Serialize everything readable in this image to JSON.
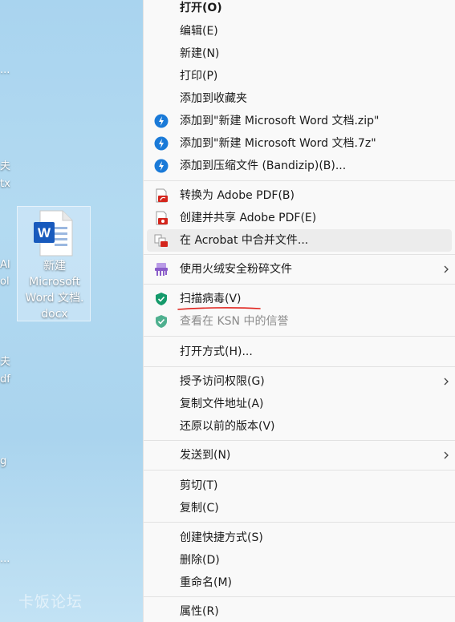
{
  "desktop": {
    "fragments": [
      "...",
      "夫",
      "tx",
      "AI",
      "ol",
      "夫",
      "df",
      "g",
      "..."
    ],
    "selected_file": {
      "label_lines": [
        "新建",
        "Microsoft",
        "Word 文档.",
        "docx"
      ]
    },
    "watermark": "卡饭论坛"
  },
  "menu": {
    "items": [
      {
        "label": "打开(O)"
      },
      {
        "label": "编辑(E)"
      },
      {
        "label": "新建(N)"
      },
      {
        "label": "打印(P)"
      },
      {
        "label": "添加到收藏夹"
      },
      {
        "label": "添加到\"新建 Microsoft Word 文档.zip\""
      },
      {
        "label": "添加到\"新建 Microsoft Word 文档.7z\""
      },
      {
        "label": "添加到压缩文件 (Bandizip)(B)..."
      },
      {
        "label": "转换为 Adobe PDF(B)"
      },
      {
        "label": "创建并共享 Adobe PDF(E)"
      },
      {
        "label": "在 Acrobat 中合并文件..."
      },
      {
        "label": "使用火绒安全粉碎文件"
      },
      {
        "label": "扫描病毒(V)"
      },
      {
        "label": "查看在 KSN 中的信誉"
      },
      {
        "label": "打开方式(H)..."
      },
      {
        "label": "授予访问权限(G)"
      },
      {
        "label": "复制文件地址(A)"
      },
      {
        "label": "还原以前的版本(V)"
      },
      {
        "label": "发送到(N)"
      },
      {
        "label": "剪切(T)"
      },
      {
        "label": "复制(C)"
      },
      {
        "label": "创建快捷方式(S)"
      },
      {
        "label": "删除(D)"
      },
      {
        "label": "重命名(M)"
      },
      {
        "label": "属性(R)"
      }
    ]
  },
  "colors": {
    "bandizip": "#1a7ad8",
    "adobe_red": "#d4251c",
    "huorong_purple": "#8a5cc9",
    "kaspersky_green": "#159a6b",
    "annotation_red": "#e0201a"
  }
}
